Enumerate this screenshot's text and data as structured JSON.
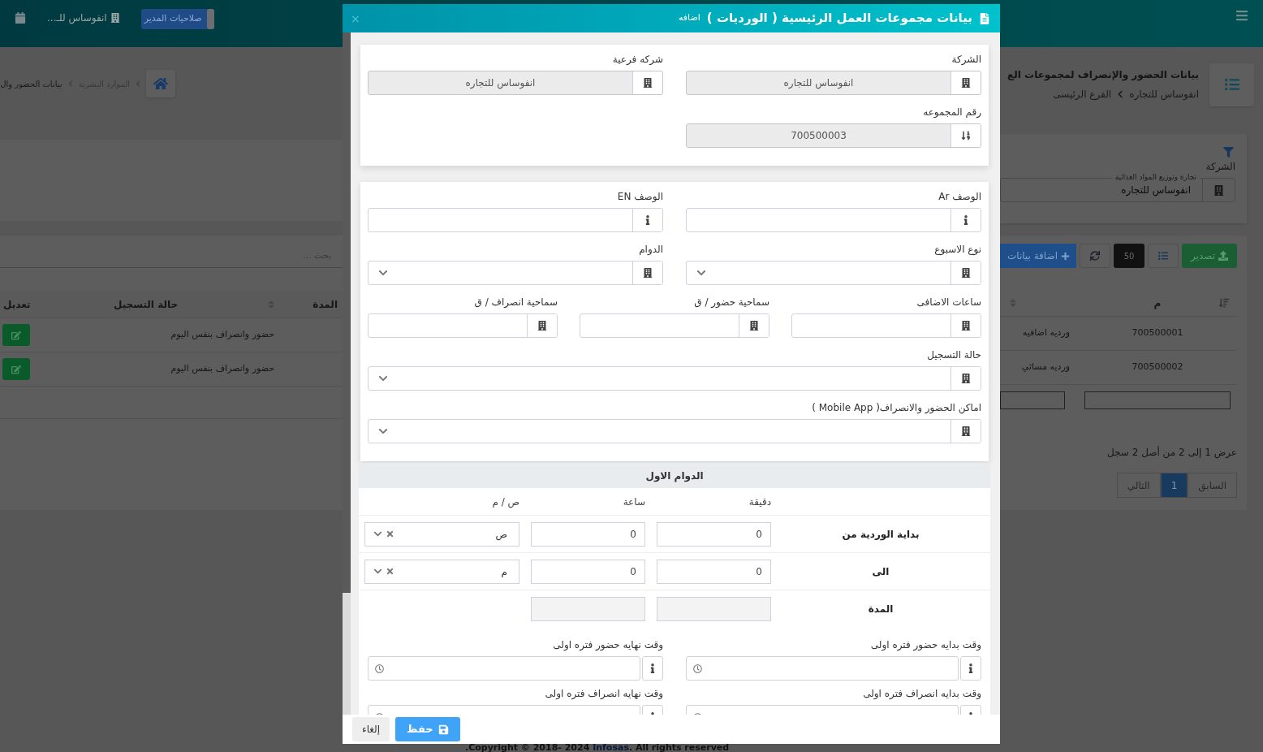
{
  "header": {
    "role_badge": "صلاحيات المدير",
    "company": "انفوساس للـ..."
  },
  "breadcrumb": {
    "items": [
      "الموارد البشرية",
      "بيانات الحضور وال"
    ]
  },
  "page": {
    "title": "بيانات الحضور والإنصراف لمجموعات الع",
    "path": [
      "انفوساس للتجاره",
      "الفرع الرئيسى"
    ]
  },
  "filter": {
    "label": "الشركة",
    "field_label": "تجارة وتوزيع المواد الغذائية",
    "value": "انفوساس للتجاره"
  },
  "toolbar": {
    "export": "تصدير",
    "page_size": "50",
    "add": "اضافة بيانات"
  },
  "search": {
    "placeholder": "بحث ..."
  },
  "table": {
    "columns": [
      {
        "label": "م"
      },
      {
        "label": "المدة"
      },
      {
        "label": "حالة التسجيل"
      },
      {
        "label": "تعديل"
      }
    ],
    "rows": [
      {
        "code": "700500001",
        "name": "ورديه اضافيه",
        "status": "حضور وانصراف بنفس اليوم"
      },
      {
        "code": "700500002",
        "name": "ورديه مسائي",
        "status": "حضور وانصراف بنفس اليوم"
      }
    ]
  },
  "pagination": {
    "summary": "عرض 1 إلى 2 من أصل 2 سجل",
    "pages": [
      {
        "label": "السابق",
        "selected": false
      },
      {
        "label": "1",
        "selected": true
      },
      {
        "label": "التالي",
        "selected": false
      }
    ]
  },
  "footer": {
    "prefix": ".Copyright © 2018- 2024",
    "link": "Infosas",
    "suffix": ". All rights reserved"
  },
  "modal": {
    "title": "بيانات مجموعات العمل الرئيسية ( الورديات )",
    "mode": "اضافه",
    "close": "×",
    "cards": [
      {
        "rows": [
          {
            "fields": [
              {
                "label": "الشركة",
                "kind": "input",
                "value": "انفوساس للتجاره",
                "disabled": true
              },
              {
                "label": "شركه فرعية",
                "kind": "input",
                "value": "انفوساس للتجاره",
                "disabled": true
              }
            ]
          },
          {
            "fields": [
              {
                "label": "رقم المجموعه",
                "kind": "input",
                "value": "700500003",
                "disabled": true
              }
            ]
          }
        ]
      },
      {
        "rows": [
          {
            "fields": [
              {
                "label": "الوصف Ar",
                "kind": "input",
                "disabled": false
              },
              {
                "label": "الوصف EN",
                "kind": "input",
                "disabled": false
              }
            ]
          },
          {
            "fields": [
              {
                "label": "نوع الاسبوع",
                "kind": "select",
                "disabled": false
              },
              {
                "label": "الدوام",
                "kind": "select",
                "disabled": false
              }
            ]
          },
          {
            "fields": [
              {
                "label": "ساعات الاضافى",
                "kind": "input",
                "disabled": false
              },
              {
                "label": "سماحية حضور / ق",
                "kind": "input",
                "disabled": false
              },
              {
                "label": "سماحية انصراف / ق",
                "kind": "input",
                "disabled": false
              }
            ]
          },
          {
            "fields": [
              {
                "label": "حالة التسجيل",
                "kind": "select",
                "disabled": false
              }
            ]
          },
          {
            "fields": [
              {
                "label": "اماكن الحضور والانصراف( Mobile App )",
                "kind": "select",
                "disabled": false
              }
            ]
          }
        ]
      }
    ],
    "shift": {
      "title": "الدوام الاول",
      "columns": [
        "دقيقة",
        "ساعة",
        "ص / م"
      ],
      "rows": [
        {
          "kind": "time",
          "label": "بداية الوردية من",
          "minute": "0",
          "hour": "0",
          "period": "ص"
        },
        {
          "kind": "time",
          "label": "الى",
          "minute": "0",
          "hour": "0",
          "period": "م"
        },
        {
          "kind": "duration",
          "label": "المدة"
        }
      ]
    },
    "time_fields": [
      {
        "label": "وقت بدايه حضور فتره اولى"
      },
      {
        "label": "وقت نهايه حضور فتره اولى"
      },
      {
        "label": "وقت بدايه انصراف فتره اولى"
      },
      {
        "label": "وقت نهايه انصراف فتره اولى"
      }
    ],
    "buttons": {
      "save": "حفظ",
      "cancel": "إلغاء"
    }
  }
}
